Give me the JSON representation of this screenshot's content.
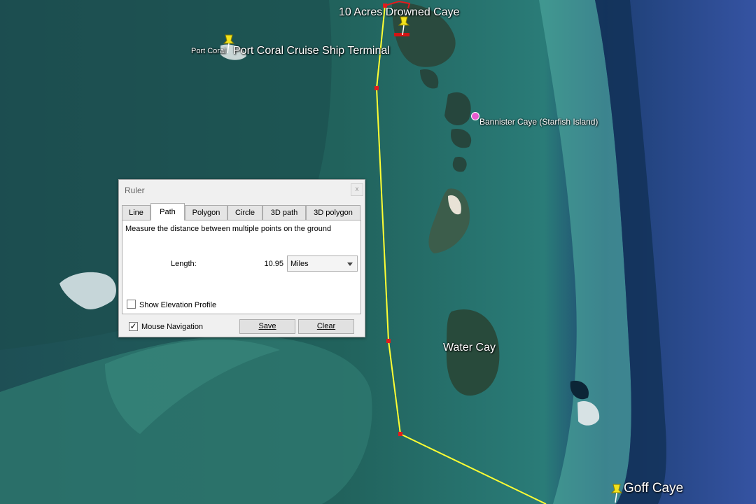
{
  "map": {
    "labels": {
      "ten_acres": "10 Acres Drowned Caye",
      "port_coral_small": "Port Coral",
      "port_coral_terminal": "Port Coral Cruise Ship Terminal",
      "bannister": "Bannister Caye (Starfish Island)",
      "water_cay": "Water Cay",
      "goff": "Goff Caye"
    },
    "path_color": "#ffff33",
    "vertex_color": "#e31a1c",
    "pin_color": "#f2e21b"
  },
  "ruler": {
    "title": "Ruler",
    "close": "x",
    "tabs": [
      "Line",
      "Path",
      "Polygon",
      "Circle",
      "3D path",
      "3D polygon"
    ],
    "active_tab": "Path",
    "description": "Measure the distance between multiple points on the ground",
    "length_label": "Length:",
    "length_value": "10.95",
    "units": "Miles",
    "show_elevation_label": "Show Elevation Profile",
    "show_elevation_checked": false,
    "mouse_nav_label": "Mouse Navigation",
    "mouse_nav_check": "✓",
    "save_label": "Save",
    "clear_label": "Clear"
  }
}
